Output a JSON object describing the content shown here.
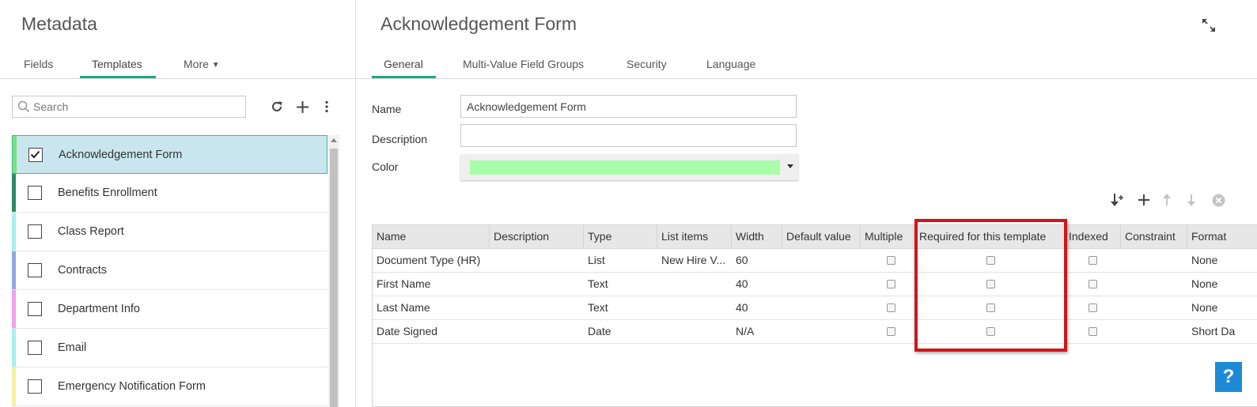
{
  "left_panel": {
    "title": "Metadata",
    "tabs": [
      {
        "label": "Fields"
      },
      {
        "label": "Templates"
      },
      {
        "label": "More"
      }
    ],
    "search": {
      "placeholder": "Search",
      "value": ""
    },
    "toolbar_icons": [
      "refresh-icon",
      "plus-icon",
      "more-vertical-icon"
    ],
    "templates": [
      {
        "label": "Acknowledgement Form",
        "color": "#7fe07f",
        "checked": true,
        "selected": true
      },
      {
        "label": "Benefits Enrollment",
        "color": "#2e8b6b",
        "checked": false
      },
      {
        "label": "Class Report",
        "color": "#a8f0ec",
        "checked": false
      },
      {
        "label": "Contracts",
        "color": "#8fa8e0",
        "checked": false
      },
      {
        "label": "Department Info",
        "color": "#f0a0f0",
        "checked": false
      },
      {
        "label": "Email",
        "color": "#a8f0ec",
        "checked": false
      },
      {
        "label": "Emergency Notification Form",
        "color": "#f4f0a0",
        "checked": false
      }
    ]
  },
  "right_panel": {
    "title": "Acknowledgement Form",
    "tabs": [
      {
        "label": "General"
      },
      {
        "label": "Multi-Value Field Groups"
      },
      {
        "label": "Security"
      },
      {
        "label": "Language"
      }
    ],
    "form": {
      "name_label": "Name",
      "name_value": "Acknowledgement Form",
      "description_label": "Description",
      "description_value": "",
      "color_label": "Color",
      "color_value": "#a9fca9"
    },
    "grid_toolbar_icons": [
      "insert-field-icon",
      "plus-icon",
      "arrow-up-icon",
      "arrow-down-icon",
      "remove-icon"
    ],
    "grid": {
      "columns": [
        "Name",
        "Description",
        "Type",
        "List items",
        "Width",
        "Default value",
        "Multiple",
        "Required for this template",
        "Indexed",
        "Constraint",
        "Format"
      ],
      "rows": [
        {
          "name": "Document Type (HR)",
          "description": "",
          "type": "List",
          "list_items": "New Hire V...",
          "width": "60",
          "default": "",
          "format": "None"
        },
        {
          "name": "First Name",
          "description": "",
          "type": "Text",
          "list_items": "",
          "width": "40",
          "default": "",
          "format": "None"
        },
        {
          "name": "Last Name",
          "description": "",
          "type": "Text",
          "list_items": "",
          "width": "40",
          "default": "",
          "format": "None"
        },
        {
          "name": "Date Signed",
          "description": "",
          "type": "Date",
          "list_items": "",
          "width": "N/A",
          "default": "",
          "format": "Short Da"
        }
      ]
    },
    "help_label": "?"
  }
}
